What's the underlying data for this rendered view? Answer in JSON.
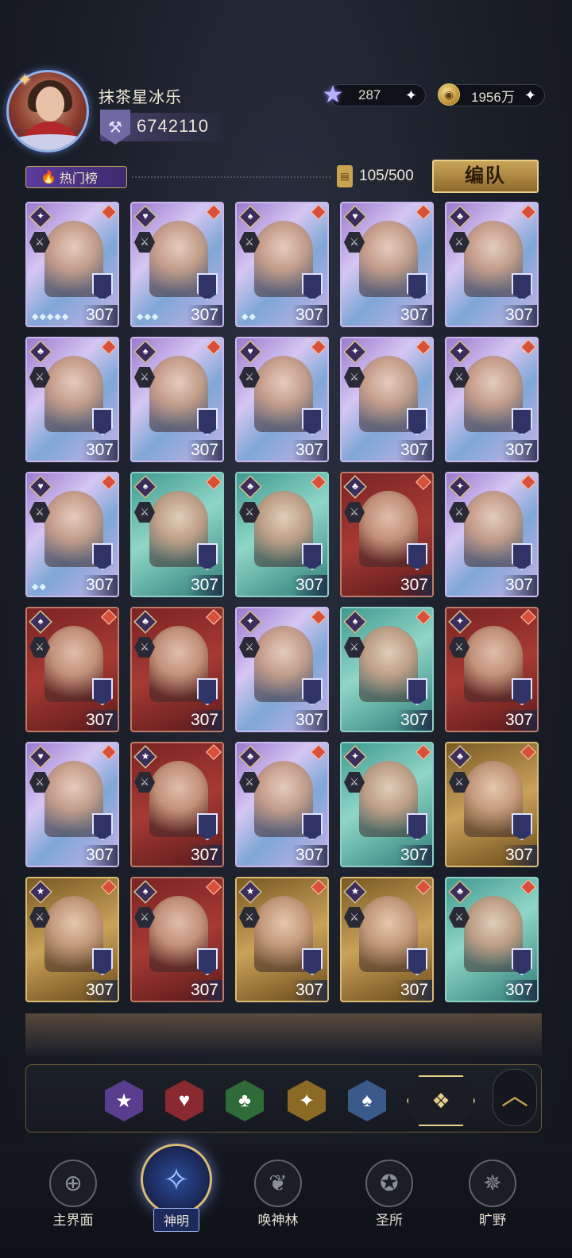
{
  "player": {
    "name": "抹茶星冰乐",
    "power": "6742110"
  },
  "resources": {
    "stars": "287",
    "coins": "1956万"
  },
  "toolbar": {
    "hot_tab_label": "热门榜",
    "collection_count": "105/500",
    "team_button_label": "编队"
  },
  "cards": [
    {
      "level": "307",
      "suit": "✦",
      "rarity": "holo",
      "stars": "◆◆◆◆◆"
    },
    {
      "level": "307",
      "suit": "♥",
      "rarity": "holo",
      "stars": "◆◆◆"
    },
    {
      "level": "307",
      "suit": "♠",
      "rarity": "holo",
      "stars": "◆◆"
    },
    {
      "level": "307",
      "suit": "♥",
      "rarity": "holo",
      "stars": ""
    },
    {
      "level": "307",
      "suit": "♣",
      "rarity": "holo",
      "stars": ""
    },
    {
      "level": "307",
      "suit": "♣",
      "rarity": "holo",
      "stars": ""
    },
    {
      "level": "307",
      "suit": "♠",
      "rarity": "holo",
      "stars": ""
    },
    {
      "level": "307",
      "suit": "♥",
      "rarity": "holo",
      "stars": ""
    },
    {
      "level": "307",
      "suit": "✦",
      "rarity": "holo",
      "stars": ""
    },
    {
      "level": "307",
      "suit": "✦",
      "rarity": "holo",
      "stars": ""
    },
    {
      "level": "307",
      "suit": "♥",
      "rarity": "holo",
      "stars": "◆◆"
    },
    {
      "level": "307",
      "suit": "♠",
      "rarity": "teal",
      "stars": ""
    },
    {
      "level": "307",
      "suit": "♣",
      "rarity": "teal",
      "stars": ""
    },
    {
      "level": "307",
      "suit": "♣",
      "rarity": "red",
      "stars": ""
    },
    {
      "level": "307",
      "suit": "✦",
      "rarity": "holo",
      "stars": ""
    },
    {
      "level": "307",
      "suit": "♠",
      "rarity": "red",
      "stars": ""
    },
    {
      "level": "307",
      "suit": "♣",
      "rarity": "red",
      "stars": ""
    },
    {
      "level": "307",
      "suit": "✦",
      "rarity": "holo",
      "stars": ""
    },
    {
      "level": "307",
      "suit": "♠",
      "rarity": "teal",
      "stars": ""
    },
    {
      "level": "307",
      "suit": "✦",
      "rarity": "red",
      "stars": ""
    },
    {
      "level": "307",
      "suit": "♥",
      "rarity": "holo",
      "stars": ""
    },
    {
      "level": "307",
      "suit": "★",
      "rarity": "red",
      "stars": ""
    },
    {
      "level": "307",
      "suit": "♣",
      "rarity": "holo",
      "stars": ""
    },
    {
      "level": "307",
      "suit": "✦",
      "rarity": "teal",
      "stars": ""
    },
    {
      "level": "307",
      "suit": "♣",
      "rarity": "gold",
      "stars": ""
    },
    {
      "level": "307",
      "suit": "★",
      "rarity": "gold",
      "stars": ""
    },
    {
      "level": "307",
      "suit": "♠",
      "rarity": "red",
      "stars": ""
    },
    {
      "level": "307",
      "suit": "★",
      "rarity": "gold",
      "stars": ""
    },
    {
      "level": "307",
      "suit": "★",
      "rarity": "gold",
      "stars": ""
    },
    {
      "level": "307",
      "suit": "♣",
      "rarity": "teal",
      "stars": ""
    }
  ],
  "filters": {
    "star": "★",
    "heart": "♥",
    "club": "♣",
    "spark": "✦",
    "spade": "♠",
    "all": "❖",
    "collapse": "︿"
  },
  "nav": {
    "world": "主界面",
    "gods": "神明",
    "summon": "唤神林",
    "sanctuary": "圣所",
    "wild": "旷野"
  }
}
